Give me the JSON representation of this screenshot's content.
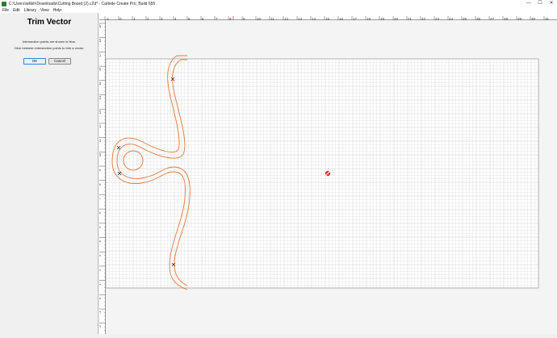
{
  "window": {
    "title": "C:\\Users\\willsh\\Downloads\\Cutting Board (2).c2d* - Carbide Create Pro, Build 655",
    "controls": {
      "minimize": "—",
      "maximize": "☐",
      "close": "✕"
    }
  },
  "menu": [
    "File",
    "Edit",
    "Library",
    "View",
    "Help"
  ],
  "panel": {
    "title": "Trim Vector",
    "line1": "Intersection points are shown in blue.",
    "line2": "Click between intersection points to trim a vector.",
    "ok_label": "OK",
    "cancel_label": "Cancel"
  },
  "rulers": {
    "horizontal_labels": [
      "-1",
      "0",
      "1",
      "2",
      "3",
      "4",
      "5",
      "6",
      "7",
      "8",
      "9",
      "10",
      "11",
      "12",
      "13",
      "14",
      "15",
      "16",
      "17",
      "18",
      "19",
      "20",
      "21",
      "22",
      "23",
      "24",
      "25",
      "26",
      "27",
      "28",
      "29",
      "30",
      "31",
      "32"
    ],
    "vertical_labels": [
      "19",
      "18",
      "17",
      "16",
      "15",
      "14",
      "13",
      "12",
      "11",
      "10",
      "9",
      "8",
      "7",
      "6",
      "5",
      "4",
      "3",
      "2",
      "1",
      "0",
      "-1",
      "-2",
      "-3"
    ]
  },
  "colors": {
    "vector_stroke": "#e8783a",
    "grid_minor": "#dddddd",
    "grid_major": "#c4c4c4",
    "origin_marker": "#e53935",
    "accent": "#3c7fd6"
  },
  "icons": {
    "app": "carbide-create-icon",
    "intersection": "intersection-marker-icon",
    "origin": "origin-marker-icon"
  }
}
